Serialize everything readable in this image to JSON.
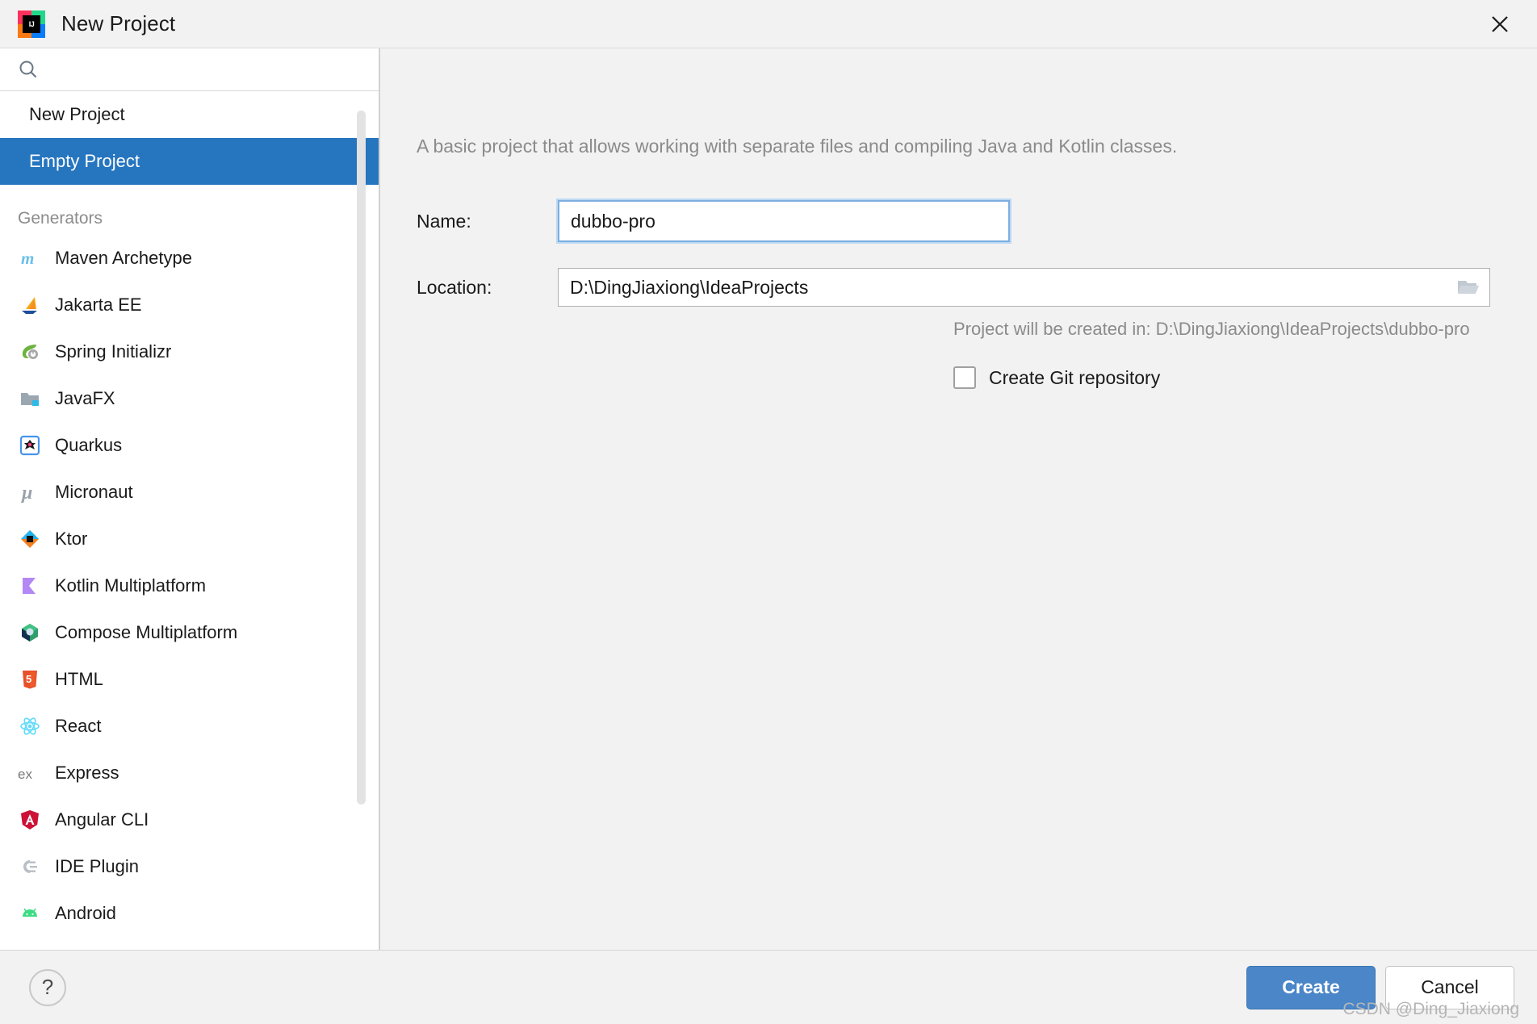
{
  "window": {
    "title": "New Project",
    "logo_text": "IJ",
    "close_label": "close-icon"
  },
  "search": {
    "value": "",
    "placeholder": ""
  },
  "sidebar": {
    "top_items": [
      {
        "label": "New Project",
        "selected": false
      },
      {
        "label": "Empty Project",
        "selected": true
      }
    ],
    "group_label": "Generators",
    "generators": [
      {
        "label": "Maven Archetype",
        "icon": "maven-icon"
      },
      {
        "label": "Jakarta EE",
        "icon": "jakarta-ee-icon"
      },
      {
        "label": "Spring Initializr",
        "icon": "spring-icon"
      },
      {
        "label": "JavaFX",
        "icon": "javafx-icon"
      },
      {
        "label": "Quarkus",
        "icon": "quarkus-icon"
      },
      {
        "label": "Micronaut",
        "icon": "micronaut-icon"
      },
      {
        "label": "Ktor",
        "icon": "ktor-icon"
      },
      {
        "label": "Kotlin Multiplatform",
        "icon": "kotlin-multiplatform-icon"
      },
      {
        "label": "Compose Multiplatform",
        "icon": "compose-multiplatform-icon"
      },
      {
        "label": "HTML",
        "icon": "html5-icon"
      },
      {
        "label": "React",
        "icon": "react-icon"
      },
      {
        "label": "Express",
        "icon": "express-icon"
      },
      {
        "label": "Angular CLI",
        "icon": "angular-icon"
      },
      {
        "label": "IDE Plugin",
        "icon": "plugin-icon"
      },
      {
        "label": "Android",
        "icon": "android-icon"
      }
    ]
  },
  "main": {
    "description": "A basic project that allows working with separate files and compiling Java and Kotlin classes.",
    "name_label": "Name:",
    "name_value": "dubbo-pro",
    "location_label": "Location:",
    "location_value": "D:\\DingJiaxiong\\IdeaProjects",
    "browse_icon": "folder-icon",
    "hint": "Project will be created in: D:\\DingJiaxiong\\IdeaProjects\\dubbo-pro",
    "git_checkbox_label": "Create Git repository",
    "git_checkbox_checked": false
  },
  "footer": {
    "help_label": "?",
    "create_label": "Create",
    "cancel_label": "Cancel",
    "watermark": "CSDN @Ding_Jiaxiong"
  },
  "colors": {
    "selection_blue": "#2675bf",
    "primary_button": "#4a86c8",
    "focus_ring": "#7daee0",
    "muted_text": "#8b8b8b"
  }
}
